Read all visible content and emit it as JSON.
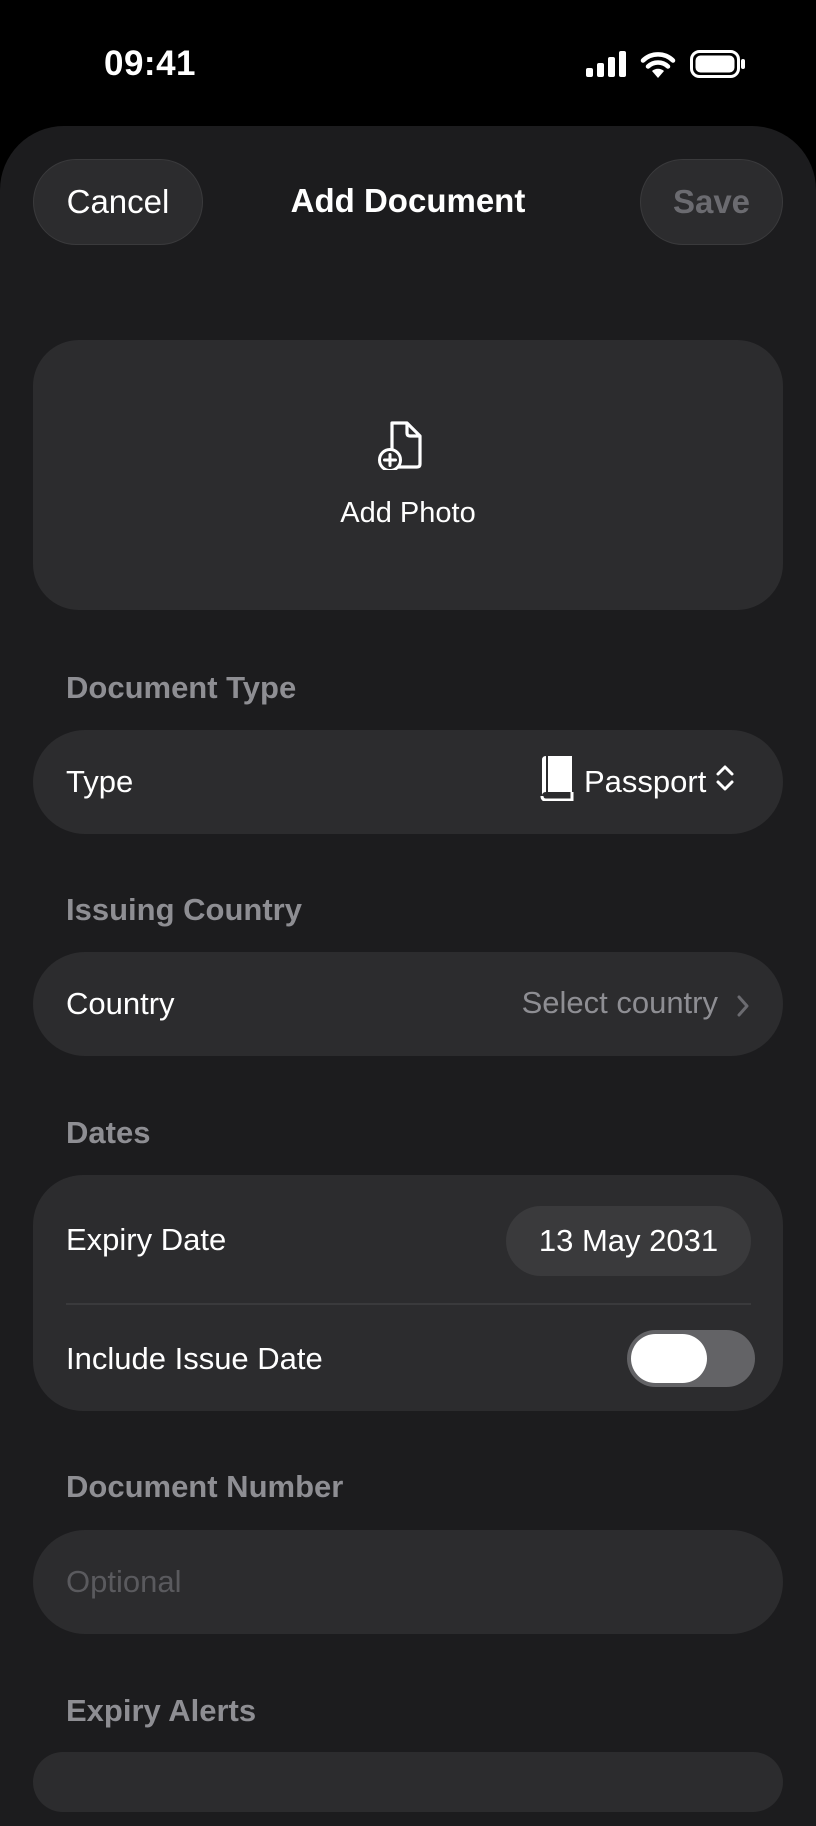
{
  "status_bar": {
    "time": "09:41",
    "icons": [
      "cellular-signal-icon",
      "wifi-icon",
      "battery-icon"
    ]
  },
  "nav": {
    "cancel_label": "Cancel",
    "title": "Add Document",
    "save_label": "Save"
  },
  "photo": {
    "label": "Add Photo",
    "icon": "document-add-icon"
  },
  "sections": {
    "document_type": {
      "header": "Document Type",
      "row_label": "Type",
      "value": "Passport",
      "value_icon": "book-icon",
      "accessory_icon": "chevron-up-down-icon"
    },
    "issuing_country": {
      "header": "Issuing Country",
      "row_label": "Country",
      "value": "Select country",
      "accessory_icon": "chevron-right-icon"
    },
    "dates": {
      "header": "Dates",
      "expiry_label": "Expiry Date",
      "expiry_value": "13 May 2031",
      "issue_label": "Include Issue Date",
      "issue_toggle_on": false
    },
    "document_number": {
      "header": "Document Number",
      "placeholder": "Optional",
      "value": ""
    },
    "expiry_alerts": {
      "header": "Expiry Alerts"
    }
  },
  "colors": {
    "background": "#000000",
    "sheet": "#1c1c1e",
    "card": "#2c2c2e",
    "secondary_text": "#8e8e93",
    "disabled_text": "#6b6b70",
    "toggle_off": "#636366"
  }
}
